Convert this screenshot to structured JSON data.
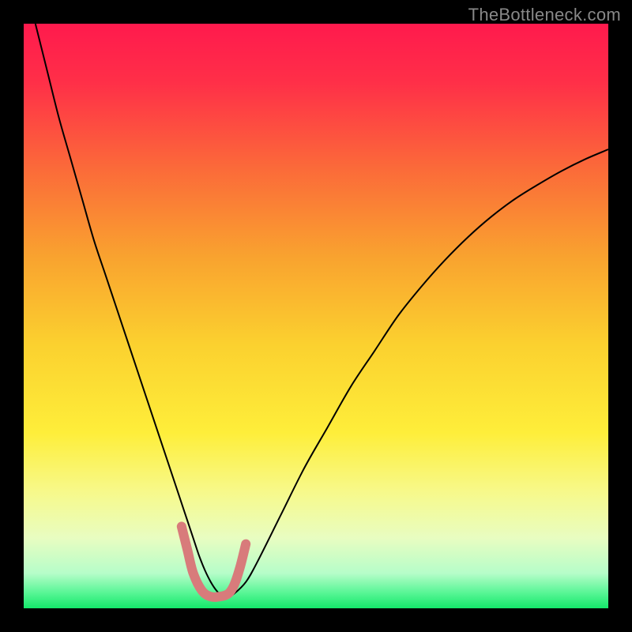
{
  "watermark": "TheBottleneck.com",
  "chart_data": {
    "type": "line",
    "title": "",
    "xlabel": "",
    "ylabel": "",
    "xlim": [
      0,
      100
    ],
    "ylim": [
      0,
      100
    ],
    "background_gradient": {
      "stops": [
        {
          "pos": 0.0,
          "color": "#ff1a4d"
        },
        {
          "pos": 0.1,
          "color": "#ff2f48"
        },
        {
          "pos": 0.25,
          "color": "#fb6b39"
        },
        {
          "pos": 0.4,
          "color": "#f9a32f"
        },
        {
          "pos": 0.55,
          "color": "#fbd12f"
        },
        {
          "pos": 0.7,
          "color": "#feee3a"
        },
        {
          "pos": 0.8,
          "color": "#f7f98a"
        },
        {
          "pos": 0.88,
          "color": "#e8fdc1"
        },
        {
          "pos": 0.94,
          "color": "#b6fdc9"
        },
        {
          "pos": 0.975,
          "color": "#54f593"
        },
        {
          "pos": 1.0,
          "color": "#14e86a"
        }
      ]
    },
    "series": [
      {
        "name": "bottleneck-curve",
        "stroke": "#000000",
        "stroke_width": 2,
        "x": [
          2,
          4,
          6,
          8,
          10,
          12,
          14,
          16,
          18,
          20,
          22,
          24,
          26,
          27,
          28,
          29,
          30,
          31,
          32,
          33,
          34,
          35,
          36,
          38,
          40,
          44,
          48,
          52,
          56,
          60,
          64,
          68,
          72,
          76,
          80,
          84,
          88,
          92,
          96,
          100
        ],
        "y": [
          100,
          92,
          84,
          77,
          70,
          63,
          57,
          51,
          45,
          39,
          33,
          27,
          21,
          18,
          15,
          12,
          9,
          6.5,
          4.5,
          3,
          2,
          2,
          2.5,
          4.5,
          8,
          16,
          24,
          31,
          38,
          44,
          50,
          55,
          59.5,
          63.5,
          67,
          70,
          72.5,
          74.8,
          76.8,
          78.5
        ]
      },
      {
        "name": "optimal-zone-marker",
        "stroke": "#d87b7b",
        "stroke_width": 12,
        "stroke_linecap": "round",
        "x": [
          27.0,
          28.0,
          29.0,
          30.5,
          32.0,
          33.5,
          35.0,
          36.0,
          37.0,
          38.0
        ],
        "y": [
          14.0,
          10.0,
          6.0,
          3.0,
          2.0,
          2.0,
          2.5,
          4.0,
          7.0,
          11.0
        ]
      }
    ],
    "annotations": []
  }
}
